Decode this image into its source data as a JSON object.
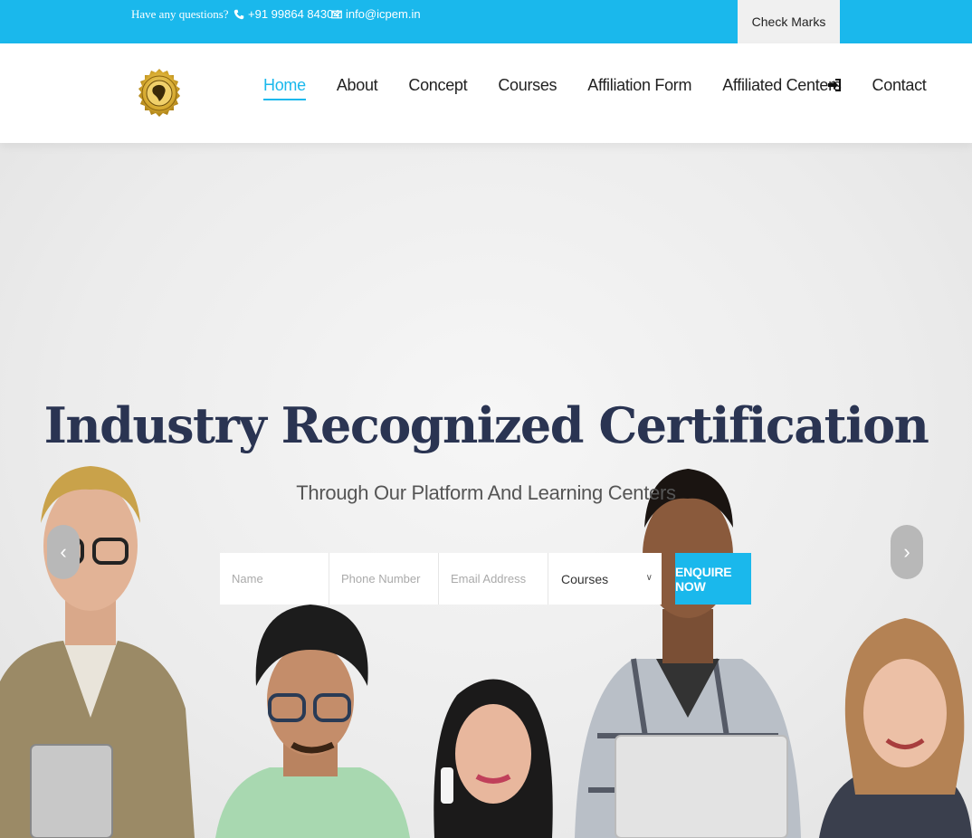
{
  "topbar": {
    "question": "Have any questions?",
    "phone": "+91 99864 84304",
    "email": "info@icpem.in",
    "check_marks": "Check Marks"
  },
  "nav": {
    "items": [
      {
        "label": "Home",
        "active": true
      },
      {
        "label": "About"
      },
      {
        "label": "Concept"
      },
      {
        "label": "Courses"
      },
      {
        "label": "Affiliation Form"
      },
      {
        "label": "Affiliated Centers"
      },
      {
        "label": "Contact"
      }
    ],
    "login_icon": "sign-in-icon"
  },
  "hero": {
    "title": "Industry Recognized Certification",
    "subtitle": "Through Our Platform And Learning Centers",
    "prev": "‹",
    "next": "›"
  },
  "form": {
    "name_placeholder": "Name",
    "phone_placeholder": "Phone Number",
    "email_placeholder": "Email Address",
    "course_selected": "Courses",
    "submit_label": "ENQUIRE NOW"
  },
  "colors": {
    "accent": "#1ab8ec",
    "title": "#2a3452"
  }
}
